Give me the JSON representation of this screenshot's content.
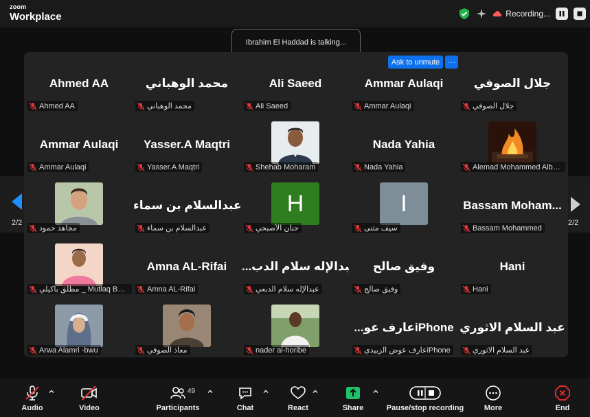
{
  "app": {
    "logo_small": "zoom",
    "logo_big": "Workplace",
    "recording_text": "Recording..."
  },
  "talking_indicator": "Ibrahim El Haddad is talking...",
  "unmute": {
    "label": "Ask to unmute",
    "more": "···"
  },
  "pagination": {
    "left": "2/2",
    "right": "2/2"
  },
  "participants": [
    {
      "name": "Ahmed AA",
      "label": "Ahmed AA"
    },
    {
      "name": "محمد الوهباني",
      "label": "محمد الوهباني"
    },
    {
      "name": "Ali Saeed",
      "label": "Ali Saeed"
    },
    {
      "name": "Ammar Aulaqi",
      "label": "Ammar Aulaqi"
    },
    {
      "name": "جلال الصوفي",
      "label": "جلال الصوفي"
    },
    {
      "name": "Ammar Aulaqi",
      "label": "Ammar Aulaqi"
    },
    {
      "name": "Yasser.A Maqtri",
      "label": "Yasser.A Maqtri"
    },
    {
      "name": "",
      "label": "Shehab Moharam"
    },
    {
      "name": "Nada Yahia",
      "label": "Nada Yahia"
    },
    {
      "name": "",
      "label": "Alemad Mohammed Alba..."
    },
    {
      "name": "",
      "label": "مجاهد حمود"
    },
    {
      "name": "عبدالسلام بن سماء",
      "label": "عبدالسلام بن سماء"
    },
    {
      "name": "",
      "initial": "H",
      "label": "حنان الأصبحي"
    },
    {
      "name": "",
      "initial": "I",
      "label": "سيف مثنى"
    },
    {
      "name": "Bassam  Moham...",
      "label": "Bassam Mohammed"
    },
    {
      "name": "",
      "label": "مطلق باكيلي _ Mutlaq Bak..."
    },
    {
      "name": "Amna AL-Rifai",
      "label": "Amna AL-Rifai"
    },
    {
      "name": "...عبدالإله سلام الدب",
      "label": "عبدالإله سلام الدبعي"
    },
    {
      "name": "وفيق صالح",
      "label": "وفيق صالح"
    },
    {
      "name": "Hani",
      "label": "Hani"
    },
    {
      "name": "",
      "label": "Arwa Alamri -bwu"
    },
    {
      "name": "",
      "label": "معاذ الصوفي"
    },
    {
      "name": "",
      "label": "nader al-horibe"
    },
    {
      "name": "...عارف عوiPhone",
      "label": "عارف عوض الزبيديiPhone"
    },
    {
      "name": "عبد السلام الاثوري",
      "label": "عبد السلام الاثوري"
    }
  ],
  "toolbar": {
    "audio": "Audio",
    "video": "Video",
    "participants": "Participants",
    "participants_count": "49",
    "chat": "Chat",
    "react": "React",
    "share": "Share",
    "record": "Pause/stop recording",
    "more": "More",
    "end": "End"
  },
  "colors": {
    "accent_blue": "#0e71eb",
    "share_green": "#1fc16b",
    "end_red": "#e02828",
    "muted_red": "#e0363a"
  }
}
